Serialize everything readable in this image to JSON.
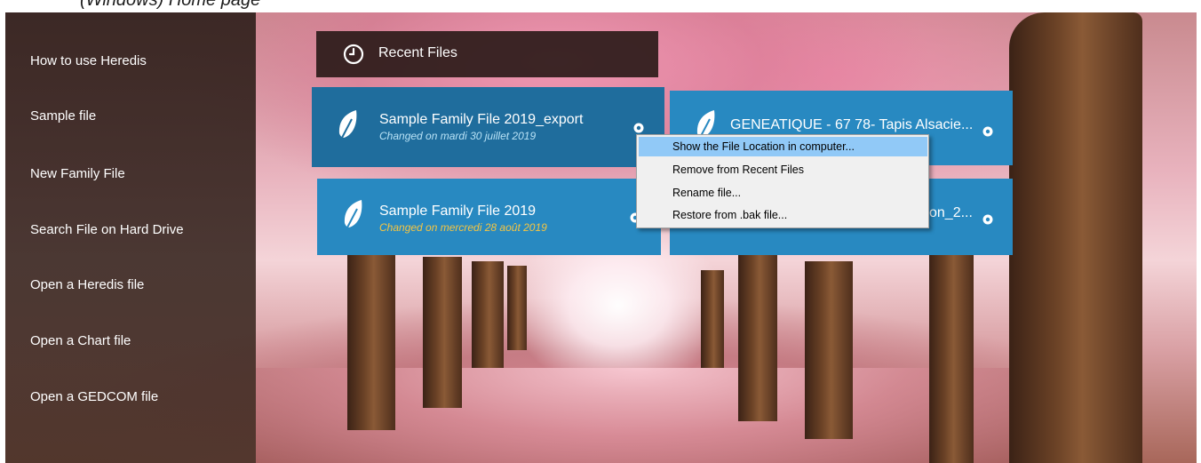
{
  "caption": "(Windows) Home page",
  "sidebar": {
    "items": [
      {
        "label": "How to use Heredis"
      },
      {
        "label": "Sample file"
      },
      {
        "label": "New Family File"
      },
      {
        "label": "Search File on Hard Drive"
      },
      {
        "label": "Open a Heredis file"
      },
      {
        "label": "Open a Chart file"
      },
      {
        "label": "Open a GEDCOM file"
      }
    ]
  },
  "recent": {
    "title": "Recent Files",
    "files": [
      {
        "name": "Sample Family File 2019_export",
        "date": "Changed on mardi 30 juillet 2019",
        "date_color": "#b8e2f6"
      },
      {
        "name": "GENEATIQUE - 67 78- Tapis Alsacie...",
        "date": ""
      },
      {
        "name": "Sample Family File 2019",
        "date": "Changed on mercredi 28 août 2019",
        "date_color": "#f5c542"
      },
      {
        "name": "on_2...",
        "date": ""
      }
    ]
  },
  "context_menu": {
    "items": [
      {
        "label": "Show the File Location in computer..."
      },
      {
        "label": "Remove from Recent Files"
      },
      {
        "label": "Rename file..."
      },
      {
        "label": "Restore from .bak file..."
      }
    ]
  },
  "colors": {
    "card": "#2889c1",
    "card_active": "#1f6d9d",
    "menu_highlight": "#91c9f7"
  },
  "icons": {
    "recent_header": "clock-icon",
    "file": "leaf-icon",
    "file_options": "gear-icon"
  }
}
